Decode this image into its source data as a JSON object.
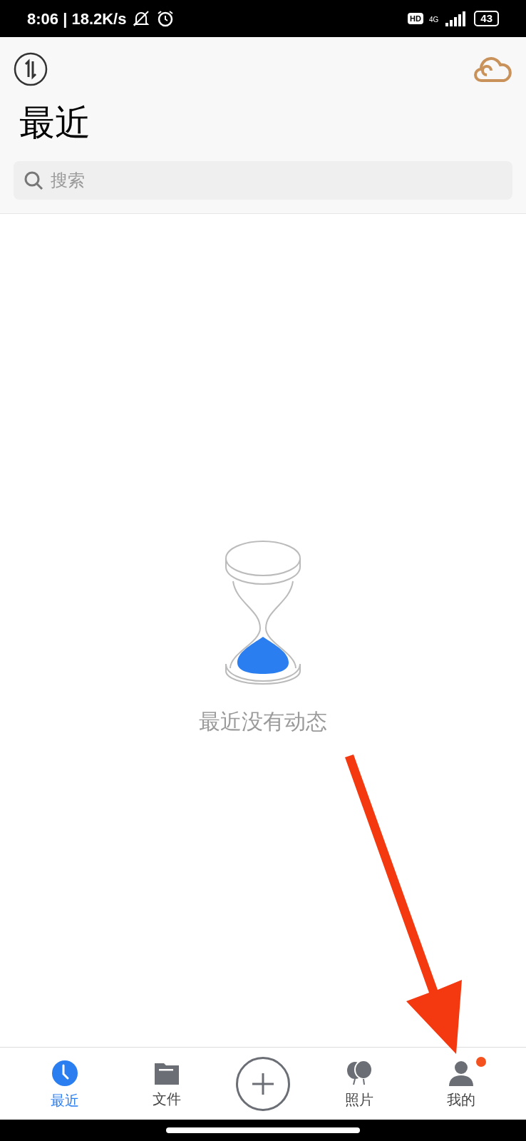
{
  "status_bar": {
    "time_speed": "8:06 | 18.2K/s",
    "hd": "HD",
    "network": "4G",
    "battery": "43"
  },
  "header": {
    "title": "最近"
  },
  "search": {
    "placeholder": "搜索"
  },
  "empty_state": {
    "message": "最近没有动态"
  },
  "tabs": [
    {
      "kind": "recent",
      "label": "最近",
      "selected": true
    },
    {
      "kind": "files",
      "label": "文件",
      "selected": false
    },
    {
      "kind": "add"
    },
    {
      "kind": "photos",
      "label": "照片",
      "selected": false
    },
    {
      "kind": "me",
      "label": "我的",
      "selected": false,
      "badge": true
    }
  ]
}
